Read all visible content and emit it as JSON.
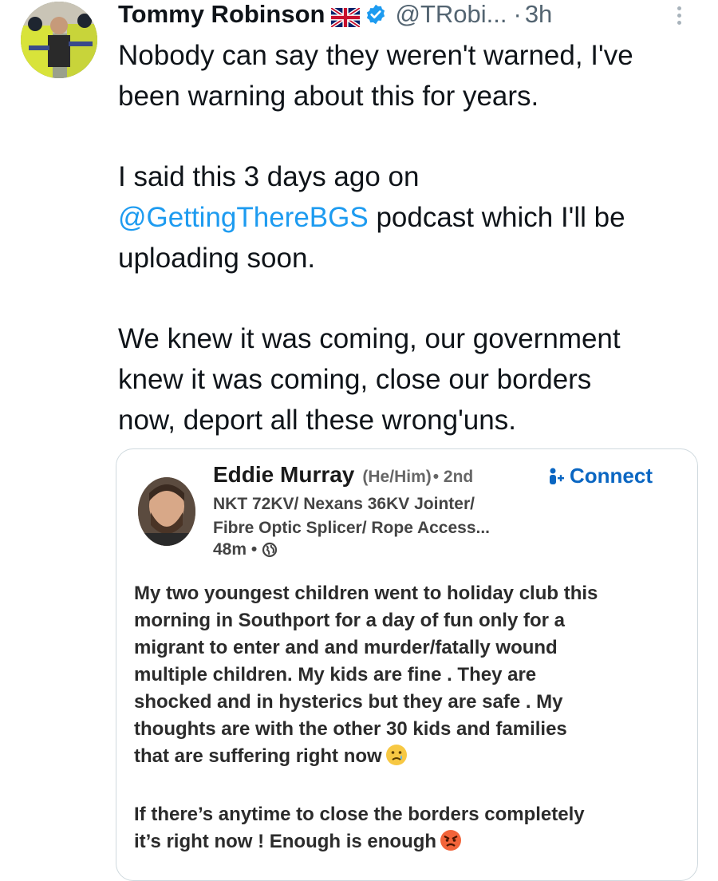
{
  "tweet": {
    "author_name": "Tommy Robinson",
    "handle": "@TRobi...",
    "separator": "·",
    "time": "3h",
    "flag_icon": "uk-flag-icon",
    "verified_icon": "verified-badge-icon",
    "text_lines": {
      "l1": "Nobody can say they weren't warned, I've",
      "l2": "been warning about this for years.",
      "l3": "I said this 3 days ago on",
      "mention": "@GettingThereBGS",
      "l4_rest": " podcast which I'll be",
      "l5": "uploading soon.",
      "l6": "We knew it was coming, our government",
      "l7": "knew it was coming, close our borders",
      "l8": "now, deport all these wrong'uns."
    }
  },
  "embedded_post": {
    "name": "Eddie Murray",
    "pronouns": "(He/Him)",
    "degree": "• 2nd",
    "connect_label": "Connect",
    "headline_1": "NKT 72KV/ Nexans 36KV Jointer/",
    "headline_2": "Fibre Optic Splicer/ Rope Access...",
    "time": "48m •",
    "body_lines": {
      "b1": "My two youngest children went to holiday club this",
      "b2": "morning in Southport  for a day of fun only for a",
      "b3": "migrant to enter and and murder/fatally wound",
      "b4": "multiple children. My kids are fine . They are",
      "b5": "shocked and in hysterics but they are safe . My",
      "b6": "thoughts are with the other 30 kids and families",
      "b7": "that are suffering right now",
      "b8": "If there’s anytime to close the borders completely",
      "b9": "it’s right now !  Enough is enough"
    }
  },
  "colors": {
    "link": "#1d9bf0",
    "linkedin_blue": "#0a66c2",
    "verified": "#1d9bf0",
    "muted": "#536471"
  }
}
